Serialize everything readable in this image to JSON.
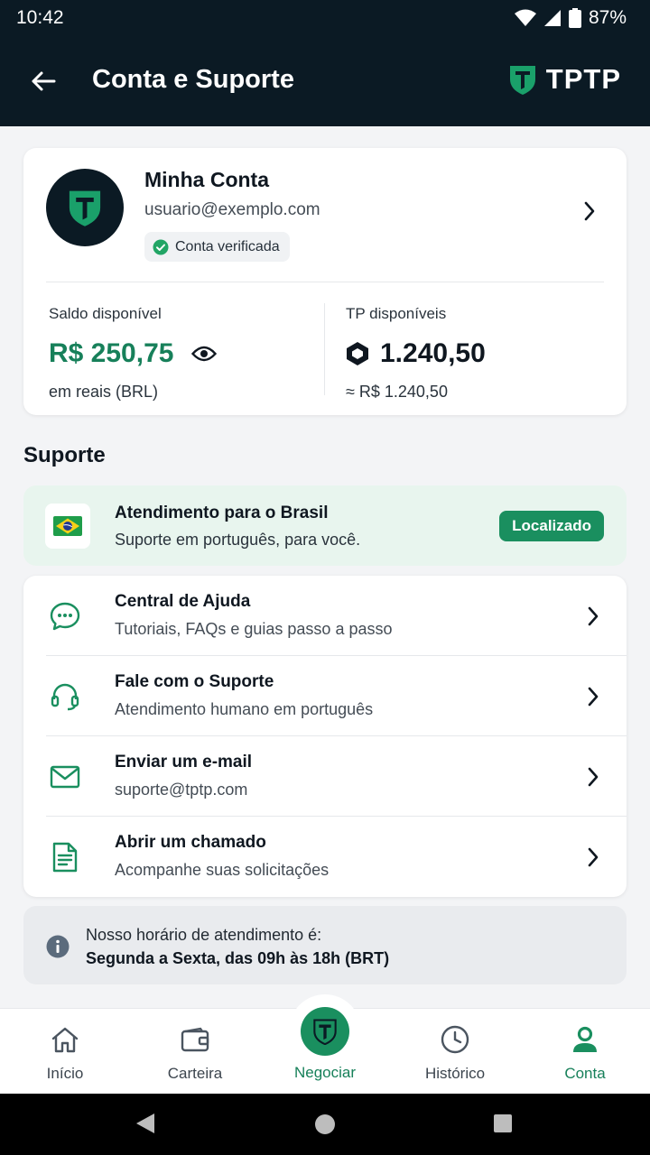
{
  "status": {
    "time": "10:42",
    "battery": "87%"
  },
  "appbar": {
    "title": "Conta e Suporte",
    "brand": "TPTP"
  },
  "account": {
    "name": "Minha Conta",
    "email": "usuario@exemplo.com",
    "verified": "Conta verificada",
    "balance": {
      "label": "Saldo disponível",
      "value": "R$ 250,75",
      "sub": "em reais (BRL)"
    },
    "tp": {
      "label": "TP disponíveis",
      "value": "1.240,50",
      "sub": "≈ R$ 1.240,50"
    }
  },
  "support": {
    "title": "Suporte",
    "brazil": {
      "title": "Atendimento para o Brasil",
      "sub": "Suporte em português, para você.",
      "badge": "Localizado"
    },
    "options": [
      {
        "icon": "chat-bubble-icon",
        "title": "Central de Ajuda",
        "sub": "Tutoriais, FAQs e guias passo a passo"
      },
      {
        "icon": "headset-icon",
        "title": "Fale com o Suporte",
        "sub": "Atendimento humano em português"
      },
      {
        "icon": "mail-icon",
        "title": "Enviar um e-mail",
        "sub": "suporte@tptp.com"
      },
      {
        "icon": "document-icon",
        "title": "Abrir um chamado",
        "sub": "Acompanhe suas solicitações"
      }
    ],
    "hours": {
      "line1": "Nosso horário de atendimento é:",
      "line2": "Segunda a Sexta, das 09h às 18h (BRT)"
    }
  },
  "nav": {
    "items": [
      {
        "label": "Início",
        "icon": "home-icon"
      },
      {
        "label": "Carteira",
        "icon": "wallet-icon"
      },
      {
        "label": "Negociar",
        "icon": "tptp-logo-icon"
      },
      {
        "label": "Histórico",
        "icon": "clock-icon"
      },
      {
        "label": "Conta",
        "icon": "user-icon"
      }
    ],
    "active": "Conta"
  },
  "colors": {
    "accent": "#1a8f5f",
    "dark": "#0b1a24",
    "brazil_bg": "#e8f5ee"
  }
}
